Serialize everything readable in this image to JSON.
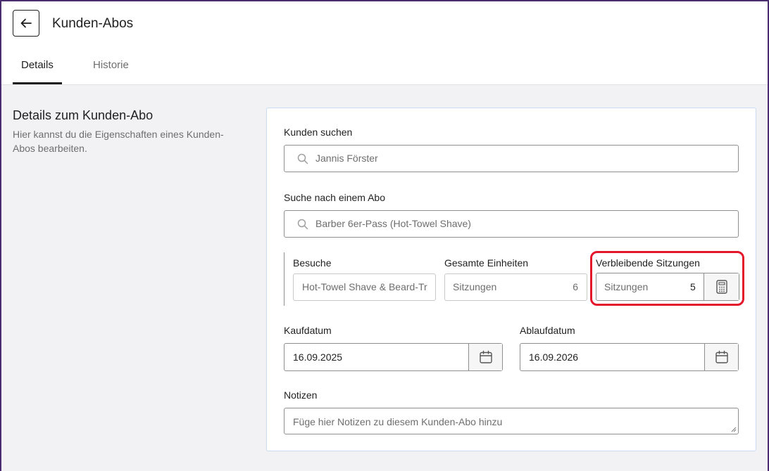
{
  "header": {
    "title": "Kunden-Abos",
    "tabs": [
      {
        "label": "Details",
        "active": true
      },
      {
        "label": "Historie",
        "active": false
      }
    ]
  },
  "section": {
    "title": "Details zum Kunden-Abo",
    "description": "Hier kannst du die Eigenschaften eines Kunden-Abos bearbeiten."
  },
  "form": {
    "customer": {
      "label": "Kunden suchen",
      "value": "Jannis Förster"
    },
    "subscription": {
      "label": "Suche nach einem Abo",
      "value": "Barber 6er-Pass (Hot-Towel Shave)"
    },
    "visits": {
      "label": "Besuche",
      "value": "Hot-Towel Shave & Beard-Trim"
    },
    "total_units": {
      "label": "Gesamte Einheiten",
      "unit": "Sitzungen",
      "value": "6"
    },
    "remaining": {
      "label": "Verbleibende Sitzungen",
      "unit": "Sitzungen",
      "value": "5"
    },
    "purchase_date": {
      "label": "Kaufdatum",
      "value": "16.09.2025"
    },
    "expiry_date": {
      "label": "Ablaufdatum",
      "value": "16.09.2026"
    },
    "notes": {
      "label": "Notizen",
      "placeholder": "Füge hier Notizen zu diesem Kunden-Abo hinzu"
    }
  },
  "colors": {
    "highlight": "#e5172a",
    "frame": "#4b2c6e",
    "card_border": "#c9dcf0"
  }
}
